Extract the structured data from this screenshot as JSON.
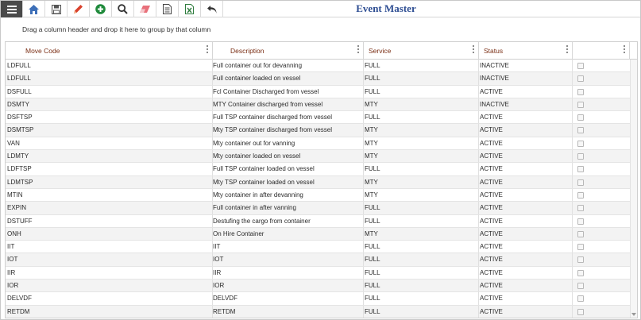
{
  "toolbar": {
    "icons": [
      "menu-icon",
      "home-icon",
      "save-icon",
      "edit-icon",
      "add-icon",
      "search-icon",
      "eraser-icon",
      "document-icon",
      "excel-icon",
      "undo-icon"
    ],
    "title": "Event Master"
  },
  "grid": {
    "group_hint": "Drag a column header and drop it here to group by that column",
    "columns": [
      "Move Code",
      "Description",
      "Service",
      "Status",
      ""
    ],
    "rows": [
      {
        "move_code": "LDFULL",
        "description": "Full container out for devanning",
        "service": "FULL",
        "status": "INACTIVE"
      },
      {
        "move_code": "LDFULL",
        "description": "Full container loaded on vessel",
        "service": "FULL",
        "status": "INACTIVE"
      },
      {
        "move_code": "DSFULL",
        "description": "Fcl Container Discharged from vessel",
        "service": "FULL",
        "status": "ACTIVE"
      },
      {
        "move_code": "DSMTY",
        "description": "MTY Container discharged from vessel",
        "service": "MTY",
        "status": "INACTIVE"
      },
      {
        "move_code": "DSFTSP",
        "description": "Full TSP container discharged from vessel",
        "service": "FULL",
        "status": "ACTIVE"
      },
      {
        "move_code": "DSMTSP",
        "description": "Mty TSP container discharged from vessel",
        "service": "MTY",
        "status": "ACTIVE"
      },
      {
        "move_code": "VAN",
        "description": "Mty container out for vanning",
        "service": "MTY",
        "status": "ACTIVE"
      },
      {
        "move_code": "LDMTY",
        "description": "Mty container loaded on vessel",
        "service": "MTY",
        "status": "ACTIVE"
      },
      {
        "move_code": "LDFTSP",
        "description": "Full TSP container loaded on vessel",
        "service": "FULL",
        "status": "ACTIVE"
      },
      {
        "move_code": "LDMTSP",
        "description": "Mty TSP container loaded on vessel",
        "service": "MTY",
        "status": "ACTIVE"
      },
      {
        "move_code": "MTIN",
        "description": "Mty container in after devanning",
        "service": "MTY",
        "status": "ACTIVE"
      },
      {
        "move_code": "EXPIN",
        "description": "Full container in after vanning",
        "service": "FULL",
        "status": "ACTIVE"
      },
      {
        "move_code": "DSTUFF",
        "description": "Destufing the cargo from container",
        "service": "FULL",
        "status": "ACTIVE"
      },
      {
        "move_code": "ONH",
        "description": "On Hire Container",
        "service": "MTY",
        "status": "ACTIVE"
      },
      {
        "move_code": "IIT",
        "description": "IIT",
        "service": "FULL",
        "status": "ACTIVE"
      },
      {
        "move_code": "IOT",
        "description": "IOT",
        "service": "FULL",
        "status": "ACTIVE"
      },
      {
        "move_code": "IIR",
        "description": "IIR",
        "service": "FULL",
        "status": "ACTIVE"
      },
      {
        "move_code": "IOR",
        "description": "IOR",
        "service": "FULL",
        "status": "ACTIVE"
      },
      {
        "move_code": "DELVDF",
        "description": "DELVDF",
        "service": "FULL",
        "status": "ACTIVE"
      },
      {
        "move_code": "RETDM",
        "description": "RETDM",
        "service": "FULL",
        "status": "ACTIVE"
      }
    ]
  },
  "colors": {
    "title": "#2d4d92",
    "header_text": "#7a2e14",
    "menu_bg": "#4a4a4a",
    "row_alt": "#f3f3f3"
  }
}
